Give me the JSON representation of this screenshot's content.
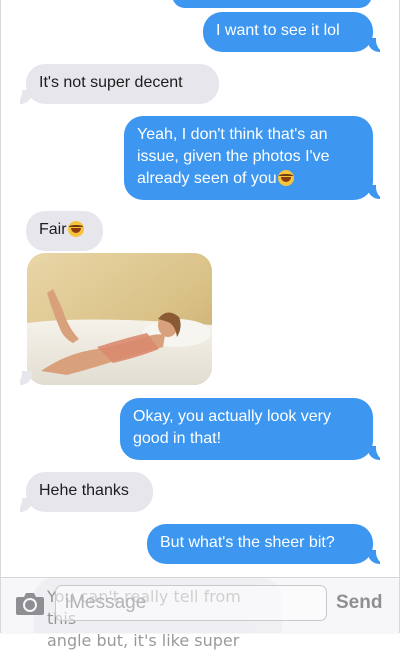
{
  "thread": {
    "messages": [
      {
        "from": "me",
        "text": "I want to see it lol"
      },
      {
        "from": "them",
        "text": "It's not super decent"
      },
      {
        "from": "me",
        "line1": "Yeah, I don't think that's an",
        "line2": "issue, given the photos I've",
        "line3": "already seen of you",
        "emoji": "laughing-emoji"
      },
      {
        "from": "them",
        "text": "Fair",
        "emoji": "laughing-emoji"
      },
      {
        "from": "them",
        "image": "photo-attachment"
      },
      {
        "from": "me",
        "line1": "Okay, you actually look very",
        "line2": "good in that!"
      },
      {
        "from": "them",
        "text": "Hehe thanks"
      },
      {
        "from": "me",
        "text": "But what's the sheer bit?"
      },
      {
        "from": "them",
        "line1": "You can't really tell from this",
        "line2": "angle but, it's like super"
      }
    ]
  },
  "composer": {
    "placeholder": "iMessage",
    "send_label": "Send",
    "camera_icon": "camera-icon"
  },
  "colors": {
    "outgoing": "#3d97f1",
    "incoming": "#e7e6ec",
    "send_disabled": "#8e8e93"
  }
}
